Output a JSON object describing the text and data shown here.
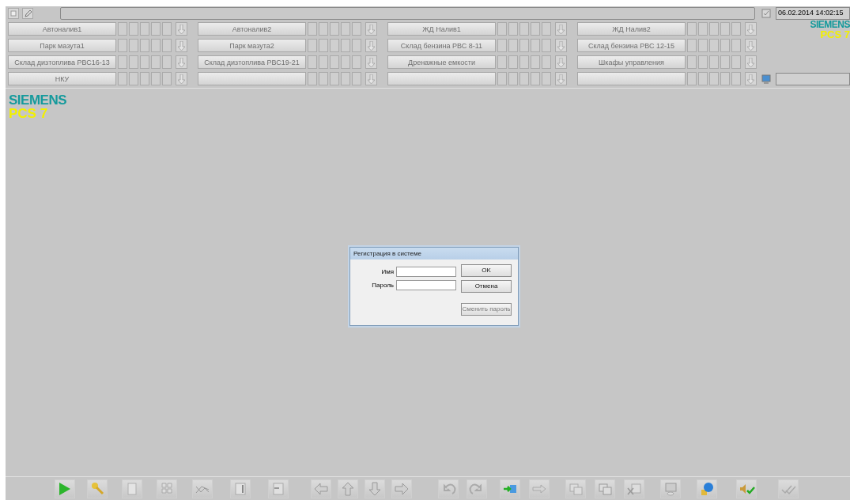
{
  "header": {
    "datetime": "06.02.2014 14:02:15",
    "logo": {
      "brand": "SIEMENS",
      "product": "PCS 7"
    }
  },
  "areas": [
    {
      "kind": "named",
      "label": "Автоналив1"
    },
    {
      "kind": "named",
      "label": "Автоналив2"
    },
    {
      "kind": "named",
      "label": "ЖД Налив1"
    },
    {
      "kind": "named",
      "label": "ЖД Налив2"
    },
    {
      "kind": "named",
      "label": "Парк мазута1"
    },
    {
      "kind": "named",
      "label": "Парк мазута2"
    },
    {
      "kind": "named",
      "label": "Склад бензина РВС 8-11"
    },
    {
      "kind": "named",
      "label": "Склад бензина РВС 12-15"
    },
    {
      "kind": "named",
      "label": "Склад дизтоплива РВС16-13"
    },
    {
      "kind": "named",
      "label": "Склад дизтоплива РВС19-21"
    },
    {
      "kind": "named",
      "label": "Дренажные емкости"
    },
    {
      "kind": "named",
      "label": "Шкафы управления"
    },
    {
      "kind": "named",
      "label": "НКУ"
    },
    {
      "kind": "blank"
    },
    {
      "kind": "blank"
    },
    {
      "kind": "blank"
    }
  ],
  "main_logo": {
    "brand": "SIEMENS",
    "product": "PCS 7"
  },
  "dialog": {
    "title": "Регистрация в системе",
    "fields": [
      {
        "label": "Имя"
      },
      {
        "label": "Пароль"
      }
    ],
    "buttons": [
      {
        "label": "OK",
        "disabled": false
      },
      {
        "label": "Отмена",
        "disabled": false
      },
      {
        "label": "Сменить пароль",
        "disabled": true
      }
    ]
  }
}
